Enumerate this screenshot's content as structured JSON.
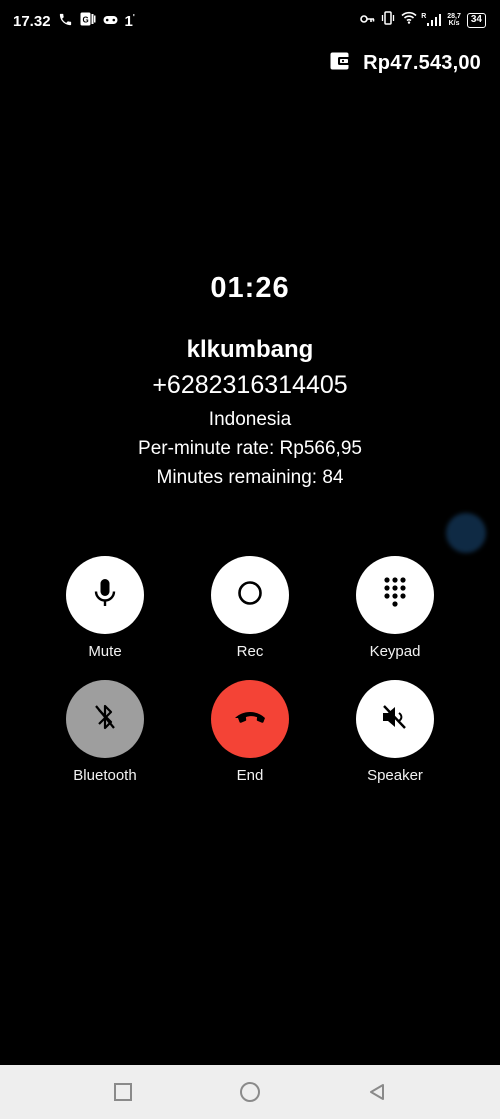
{
  "status_bar": {
    "time": "17.32",
    "extra": "1",
    "net_speed_value": "28,7",
    "net_speed_unit": "K/s",
    "signal_label": "R",
    "battery": "34",
    "icons": [
      "phone-call-icon",
      "app-notification-icon",
      "game-controller-icon",
      "key-icon",
      "vibrate-icon",
      "wifi-icon",
      "cell-signal-icon",
      "battery-icon"
    ]
  },
  "balance": {
    "icon": "wallet-icon",
    "amount": "Rp47.543,00"
  },
  "call": {
    "timer": "01:26",
    "caller_name": "klkumbang",
    "caller_number": "+6282316314405",
    "country": "Indonesia",
    "rate": "Per-minute rate: Rp566,95",
    "minutes_remaining": "Minutes remaining: 84"
  },
  "buttons": [
    {
      "label": "Mute",
      "icon": "microphone-icon",
      "color": "#ffffff"
    },
    {
      "label": "Rec",
      "icon": "record-icon",
      "color": "#ffffff"
    },
    {
      "label": "Keypad",
      "icon": "keypad-icon",
      "color": "#ffffff"
    },
    {
      "label": "Bluetooth",
      "icon": "bluetooth-off-icon",
      "color": "#9e9e9e"
    },
    {
      "label": "End",
      "icon": "end-call-icon",
      "color": "#f44336"
    },
    {
      "label": "Speaker",
      "icon": "speaker-off-icon",
      "color": "#ffffff"
    }
  ],
  "nav_bar": {
    "icons": [
      "recents-square-icon",
      "home-circle-icon",
      "back-triangle-icon"
    ]
  }
}
